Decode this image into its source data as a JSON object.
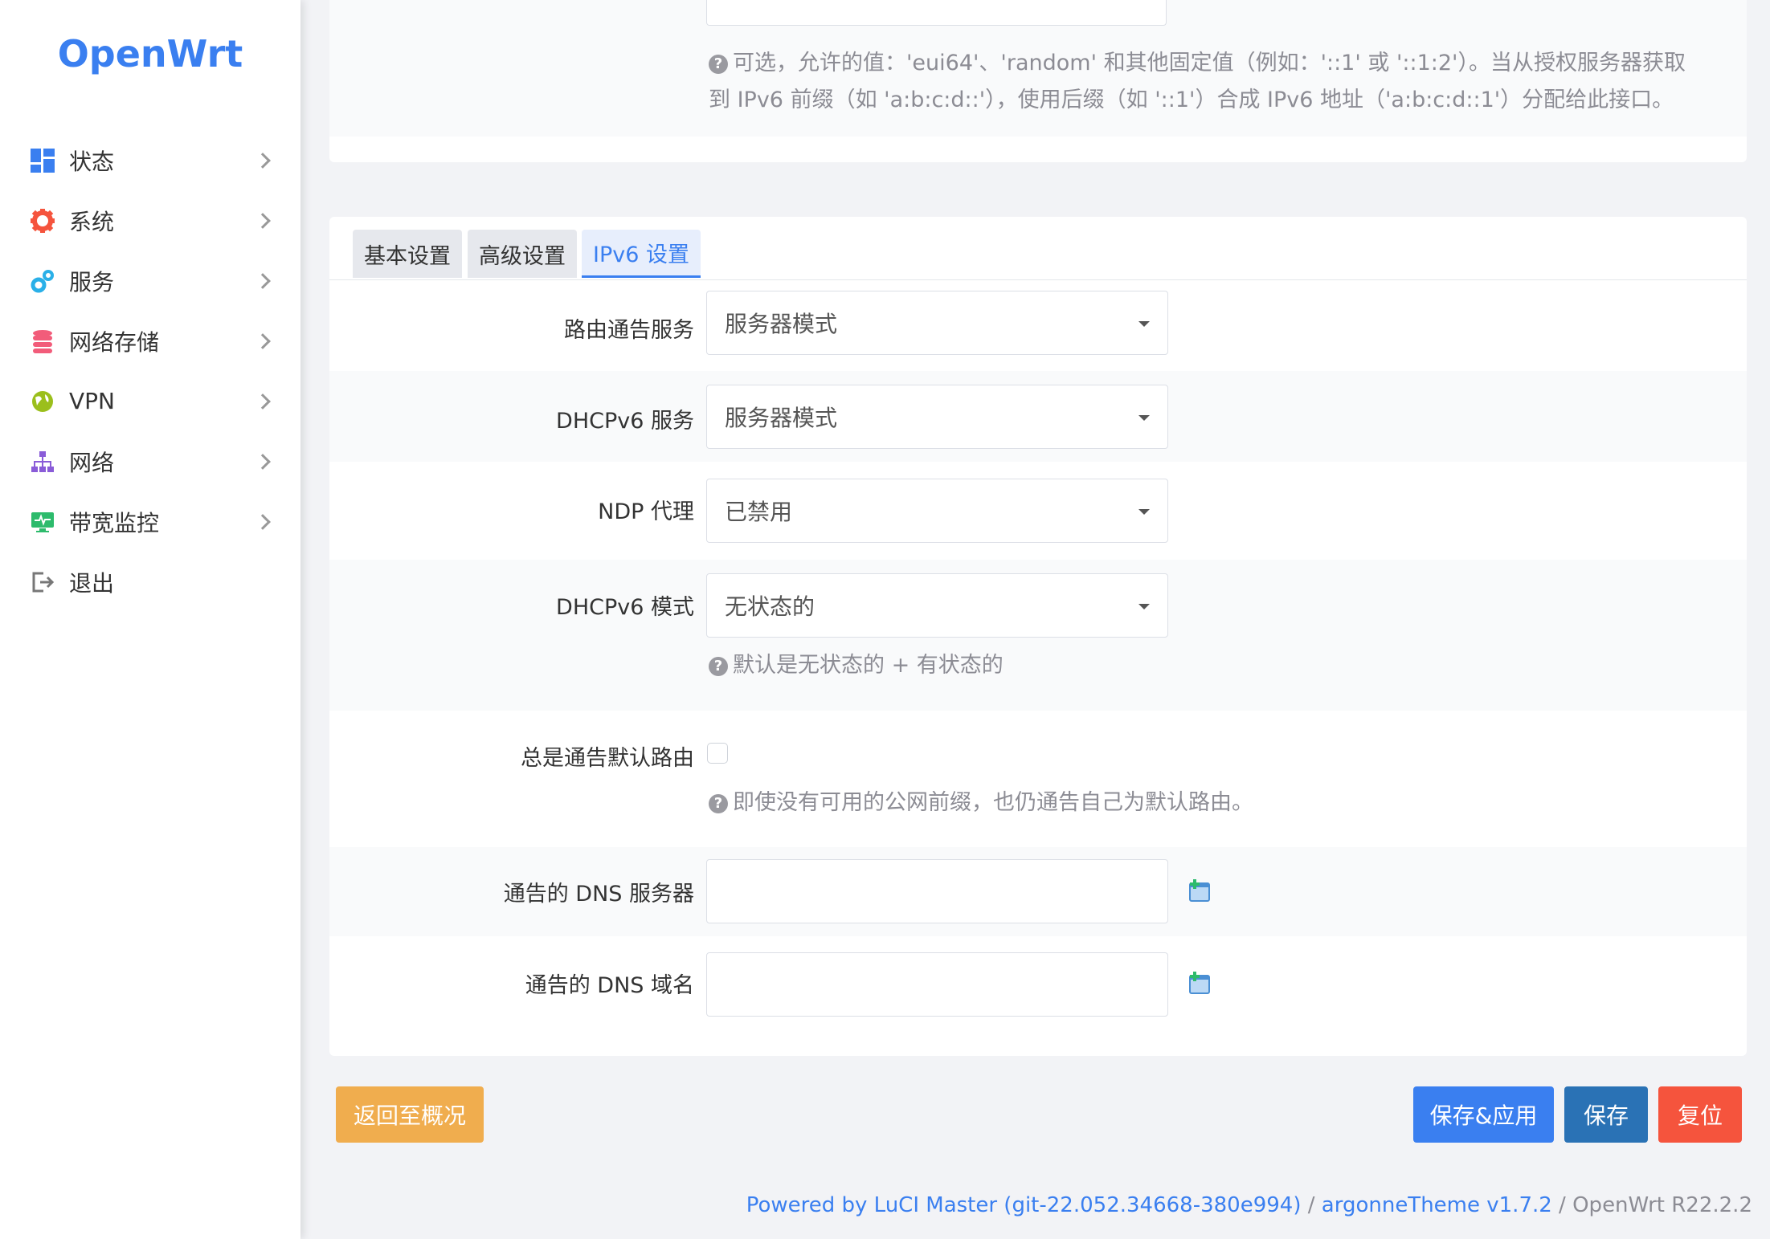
{
  "sidebar": {
    "brand": "OpenWrt",
    "items": [
      {
        "label": "状态",
        "icon": "dashboard-icon",
        "color": "#3a7ff0"
      },
      {
        "label": "系统",
        "icon": "gear-icon",
        "color": "#f5543d"
      },
      {
        "label": "服务",
        "icon": "cogs-icon",
        "color": "#2ab0e8"
      },
      {
        "label": "网络存储",
        "icon": "database-icon",
        "color": "#f25c7a"
      },
      {
        "label": "VPN",
        "icon": "globe-icon",
        "color": "#9bbf1c"
      },
      {
        "label": "网络",
        "icon": "sitemap-icon",
        "color": "#8a5cd8"
      },
      {
        "label": "带宽监控",
        "icon": "monitor-icon",
        "color": "#2dbb6c"
      },
      {
        "label": "退出",
        "icon": "logout-icon",
        "color": "#777777"
      }
    ]
  },
  "top": {
    "help_line1": "可选，允许的值：'eui64'、'random' 和其他固定值（例如：'::1' 或 '::1:2'）。当从授权服务器获取",
    "help_line2": "到 IPv6 前缀（如 'a:b:c:d::'），使用后缀（如 '::1'）合成 IPv6 地址（'a:b:c:d::1'）分配给此接口。"
  },
  "tabs": [
    {
      "label": "基本设置",
      "active": false
    },
    {
      "label": "高级设置",
      "active": false
    },
    {
      "label": "IPv6 设置",
      "active": true
    }
  ],
  "fields": {
    "ra_service": {
      "label": "路由通告服务",
      "value": "服务器模式"
    },
    "dhcpv6_service": {
      "label": "DHCPv6 服务",
      "value": "服务器模式"
    },
    "ndp_proxy": {
      "label": "NDP 代理",
      "value": "已禁用"
    },
    "dhcpv6_mode": {
      "label": "DHCPv6 模式",
      "value": "无状态的",
      "help": "默认是无状态的 + 有状态的"
    },
    "ra_default": {
      "label": "总是通告默认路由",
      "checked": false,
      "help": "即使没有可用的公网前缀，也仍通告自己为默认路由。"
    },
    "dns_servers": {
      "label": "通告的 DNS 服务器",
      "value": ""
    },
    "dns_domains": {
      "label": "通告的 DNS 域名",
      "value": ""
    }
  },
  "actions": {
    "back": "返回至概况",
    "save_apply": "保存&应用",
    "save": "保存",
    "reset": "复位"
  },
  "footer": {
    "luci": "Powered by LuCI Master (git-22.052.34668-380e994)",
    "sep1": " / ",
    "theme": "argonneTheme v1.7.2",
    "sep2": " / ",
    "os": "OpenWrt R22.2.2"
  },
  "colors": {
    "accent": "#3a7ff0",
    "warning": "#f0ad4e",
    "danger": "#f5543d",
    "save": "#2a72b5"
  }
}
